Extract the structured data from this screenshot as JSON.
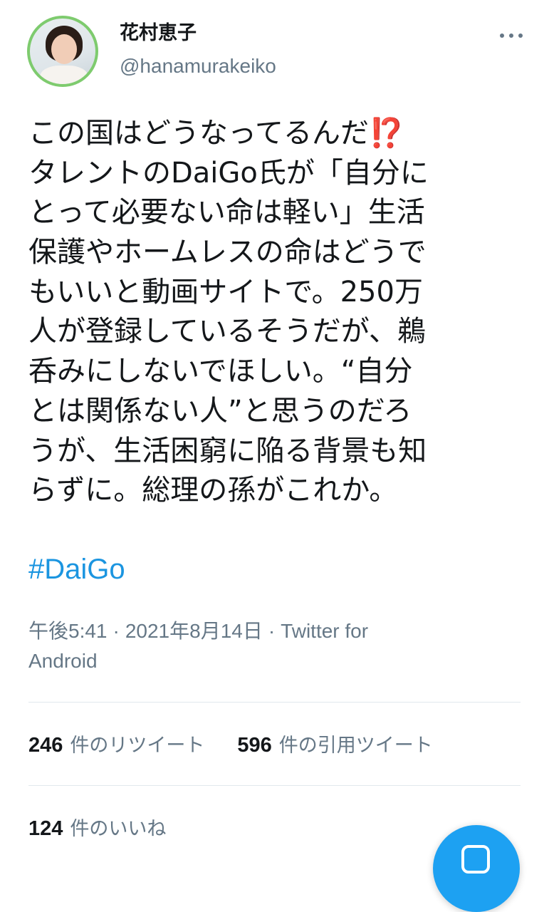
{
  "author": {
    "display_name": "花村恵子",
    "handle": "@hanamurakeiko",
    "avatar_icon": "profile-photo",
    "avatar_border_color": "#7ecb6e"
  },
  "more_icon": "more-horizontal-icon",
  "tweet": {
    "lines": [
      "この国はどうなってるんだ",
      "タレントのDaiGo氏が「自分に",
      "とって必要ない命は軽い」生活",
      "保護やホームレスの命はどうで",
      "もいいと動画サイトで。250万",
      "人が登録しているそうだが、鵜",
      "呑みにしないでほしい。“自分",
      "とは関係ない人”と思うのだろ",
      "うが、生活困窮に陥る背景も知",
      "らずに。総理の孫がこれか。"
    ],
    "emoji": "⁉️",
    "emoji_color": "#d1202f",
    "hashtag": "#DaiGo",
    "hashtag_color": "#1b95e0"
  },
  "meta": {
    "time": "午後5:41",
    "separator": "·",
    "date": "2021年8月14日",
    "source_line1": "Twitter for",
    "source_line2": "Android"
  },
  "stats": {
    "retweets": {
      "count": "246",
      "label": "件のリツイート"
    },
    "quotes": {
      "count": "596",
      "label": "件の引用ツイート"
    },
    "likes": {
      "count": "124",
      "label": "件のいいね"
    }
  },
  "compose_button": {
    "icon": "compose-icon",
    "color": "#1da1f2"
  },
  "colors": {
    "text_primary": "#14171a",
    "text_secondary": "#657786",
    "divider": "#e1e8ed"
  }
}
